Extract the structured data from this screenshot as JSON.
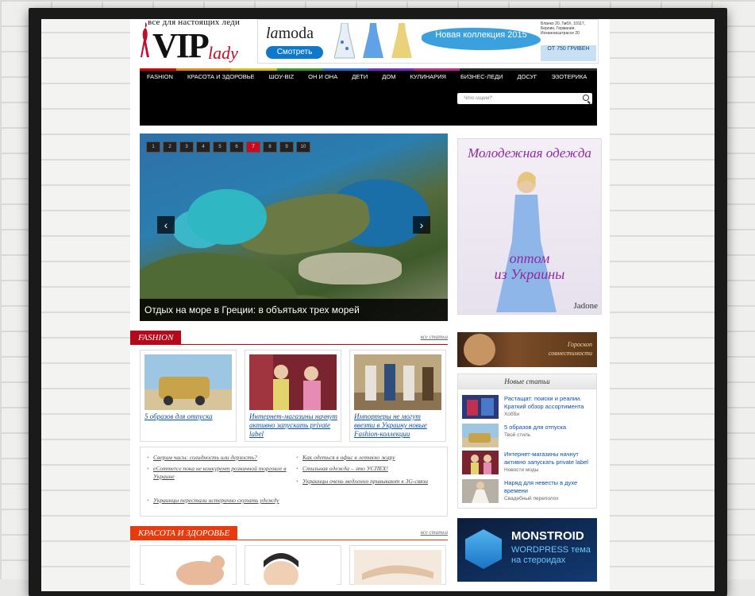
{
  "logo": {
    "tagline": "все для настоящих леди",
    "vip": "VIP",
    "lady": "lady"
  },
  "top_banner": {
    "brand_la": "la",
    "brand_moda": "moda",
    "button": "Смотреть",
    "promo": "Новая коллекция 2015",
    "fine_print": "Бланко 20, ГмбХ, 10117, Берлин, Германия. Иоханнисштрассе 20",
    "price": "ОТ 750 ГРИВЕН"
  },
  "nav": {
    "items": [
      "FASHION",
      "КРАСОТА И ЗДОРОВЬЕ",
      "ШОУ-BIZ",
      "ОН И ОНА",
      "ДЕТИ",
      "ДОМ",
      "КУЛИНАРИЯ",
      "БИЗНЕС-ЛЕДИ",
      "ДОСУГ",
      "ЭЗОТЕРИКА"
    ],
    "search_placeholder": "Что ищем?"
  },
  "slider": {
    "pages": [
      "1",
      "2",
      "3",
      "4",
      "5",
      "6",
      "7",
      "8",
      "9",
      "10"
    ],
    "active_page": "7",
    "caption": "Отдых на море в Греции: в объятьях трех морей"
  },
  "ad_right": {
    "title": "Молодежная одежда",
    "sub1": "оптом",
    "sub2": "из Украины",
    "brand": "Jadone"
  },
  "fashion": {
    "tag": "FASHION",
    "all": "все статьи",
    "color": "#b5081b",
    "cards": [
      {
        "title": "5 образов для отпуска"
      },
      {
        "title": "Интернет-магазины начнут активно запускать private label"
      },
      {
        "title": "Импортеры не могут ввезти в Украину новые Fashion-коллекции"
      }
    ],
    "links": [
      "Сверим часы: солидность или дерзость?",
      "Как одеться в офис в летнюю жару",
      "eCommerce пока не конкурент розничной торговле в Украине",
      "Стильная одежда – это УСПЕХ!",
      "Украинцы очень медленно привыкают к 3G-связи",
      "Украинцы перестали истерично скупать удежду"
    ]
  },
  "beauty": {
    "tag": "КРАСОТА И ЗДОРОВЬЕ",
    "all": "все статьи",
    "color": "#e63b0f"
  },
  "horoscope": {
    "line1": "Гороскоп",
    "line2": "совместимости"
  },
  "news": {
    "header": "Новые статьи",
    "items": [
      {
        "title": "Растащат: поиски и реалии. Краткий обзор ассортимента",
        "cat": "Хобби"
      },
      {
        "title": "5 образов для отпуска",
        "cat": "Твой стиль"
      },
      {
        "title": "Интернет-магазины начнут активно запускать private label",
        "cat": "Новости моды"
      },
      {
        "title": "Наряд для невесты в духе времени",
        "cat": "Свадебный переполох"
      }
    ]
  },
  "monstroid": {
    "title": "MONSTROID",
    "line1": "WORDPRESS тема",
    "line2": "на стероидах"
  }
}
